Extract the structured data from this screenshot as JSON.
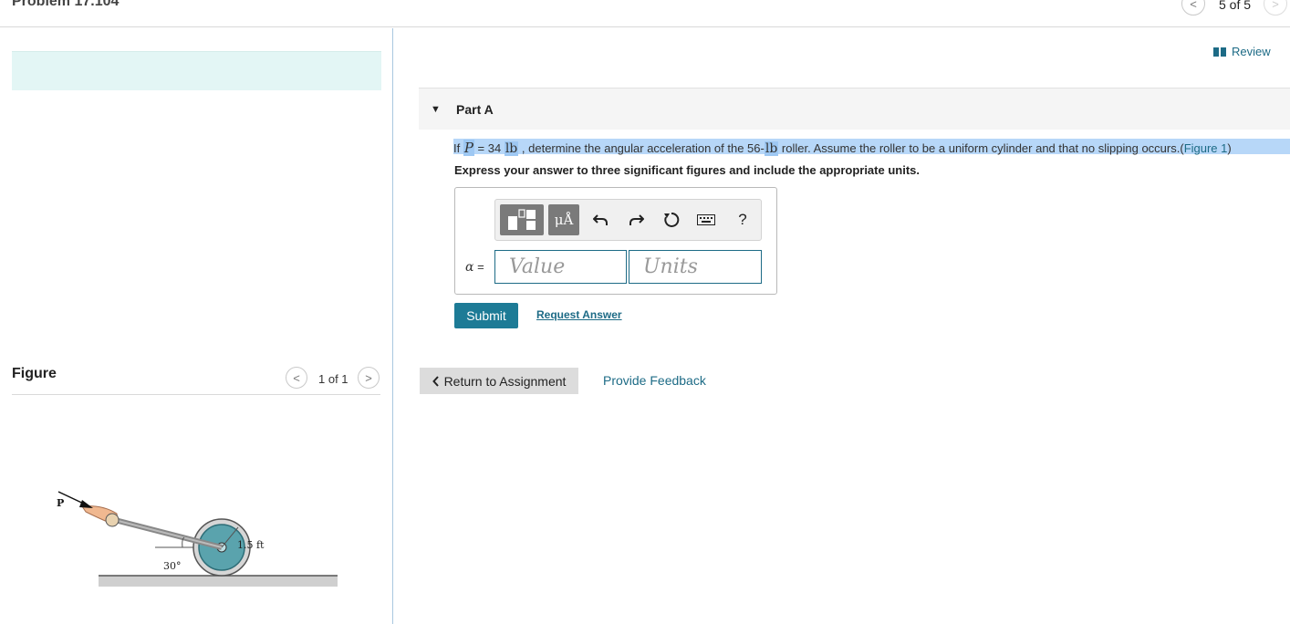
{
  "header": {
    "problem_title": "Problem 17.104",
    "prev_glyph": "<",
    "next_glyph": ">",
    "problem_count": "5 of 5"
  },
  "left": {
    "figure_label": "Figure",
    "figure_count": "1 of 1",
    "prev_glyph": "<",
    "next_glyph": ">",
    "diagram": {
      "force_label": "P",
      "angle_label": "30°",
      "radius_label": "1.5 ft"
    }
  },
  "review": {
    "label": "Review",
    "icon": "book-icon"
  },
  "part_a": {
    "toggle_glyph": "▼",
    "title": "Part A",
    "question": {
      "prefix": "If ",
      "var": "P",
      "mid1": " = 34 ",
      "unit1": "lb",
      "mid2": " , determine the angular acceleration of the 56-",
      "unit2": "lb",
      "mid3": " roller. Assume the roller to be a uniform cylinder and that no slipping occurs.(",
      "figure_ref": "Figure 1",
      "suffix": ")"
    },
    "instruction": "Express your answer to three significant figures and include the appropriate units.",
    "toolbar": {
      "units_label": "μÅ",
      "undo_icon": "undo-icon",
      "redo_icon": "redo-icon",
      "reset_icon": "reset-icon",
      "keyboard_icon": "keyboard-icon",
      "help_label": "?"
    },
    "answer": {
      "var_label": "α",
      "equals": " =",
      "value_placeholder": "Value",
      "units_placeholder": "Units"
    },
    "submit_label": "Submit",
    "request_answer_label": "Request Answer"
  },
  "footer": {
    "return_label": "Return to Assignment",
    "feedback_label": "Provide Feedback"
  },
  "colors": {
    "accent": "#1d7b96",
    "link": "#1d6b86",
    "banner": "#e3f6f5",
    "highlight": "#b7d7f8"
  }
}
